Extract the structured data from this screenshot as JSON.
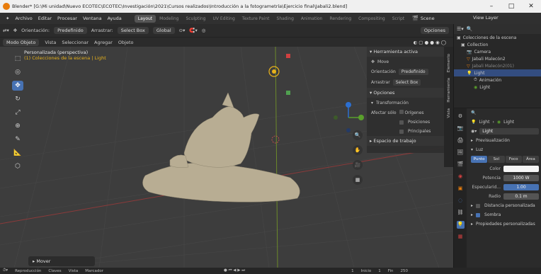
{
  "window": {
    "title": "Blender* [G:\\Mi unidad\\Nuevo ECOTEC\\ECOTEC\\Investigación\\2021\\Cursos realizados\\Introducción a la fotogrametría\\Ejercicio final\\Jabali2.blend]",
    "min": "–",
    "max": "□",
    "close": "✕"
  },
  "menu": {
    "items": [
      "Archivo",
      "Editar",
      "Procesar",
      "Ventana",
      "Ayuda"
    ],
    "workspaces": [
      "Layout",
      "Modeling",
      "Sculpting",
      "UV Editing",
      "Texture Paint",
      "Shading",
      "Animation",
      "Rendering",
      "Compositing",
      "Script"
    ],
    "scene": "Scene",
    "view_layer": "View Layer"
  },
  "header": {
    "orientation_label": "Orientación:",
    "orientation_value": "Predefinido",
    "drag_label": "Arrastrar:",
    "drag_value": "Select Box",
    "transform": "Global",
    "options": "Opciones",
    "mode": "Modo Objeto",
    "view_menu": [
      "Vista",
      "Seleccionar",
      "Agregar",
      "Objeto"
    ]
  },
  "viewport": {
    "line1": "Personalizada (perspectiva)",
    "line2": "(1) Colecciones de la escena | Light",
    "last_op": "Mover"
  },
  "npanel": {
    "tool_header": "Herramienta activa",
    "tool_name": "Move",
    "orientation_label": "Orientación",
    "orientation_value": "Predefinido",
    "drag_label": "Arrastrar",
    "drag_value": "Select Box",
    "options_header": "Opciones",
    "transform_header": "Transformación",
    "affect_label": "Afectar sólo",
    "affect_items": [
      "Orígenes",
      "Posiciones",
      "Principales"
    ],
    "workspace_header": "Espacio de trabajo",
    "tabs": [
      "Elemento",
      "Herramienta",
      "Vista"
    ]
  },
  "outliner": {
    "root": "Colecciones de la escena",
    "items": [
      {
        "label": "Collection",
        "icon": "collection-icon"
      },
      {
        "label": "Camera",
        "icon": "camera-icon"
      },
      {
        "label": "Jabali Malecón2",
        "icon": "mesh-icon"
      },
      {
        "label": "Jabali Malecón2(01)",
        "icon": "mesh-icon"
      },
      {
        "label": "Light",
        "icon": "light-icon"
      },
      {
        "label": "Animación",
        "icon": "anim-icon"
      },
      {
        "label": "Light",
        "icon": "light-data-icon"
      }
    ]
  },
  "properties": {
    "search_placeholder": "",
    "crumb": [
      "Light",
      "Light"
    ],
    "datablock": "Light",
    "preview": "Previsualización",
    "luz": "Luz",
    "light_types": [
      "Punto",
      "Sol",
      "Foco",
      "Área"
    ],
    "color_label": "Color",
    "power_label": "Potencia",
    "power_value": "1000 W",
    "specular_label": "Especularid...",
    "specular_value": "1.00",
    "radius_label": "Radio",
    "radius_value": "0.1 m",
    "custom_distance": "Distancia personalizada",
    "shadow": "Sombra",
    "custom_props": "Propiedades personalizadas"
  },
  "status": {
    "items": [
      "Reproducción",
      "Claves",
      "Vista",
      "Marcador"
    ],
    "frame": "1",
    "start_label": "Inicio",
    "start": "1",
    "end_label": "Fin",
    "end": "250"
  },
  "colors": {
    "accent": "#4772b3",
    "selection": "#e8b21b",
    "background": "#3d3d3d"
  }
}
